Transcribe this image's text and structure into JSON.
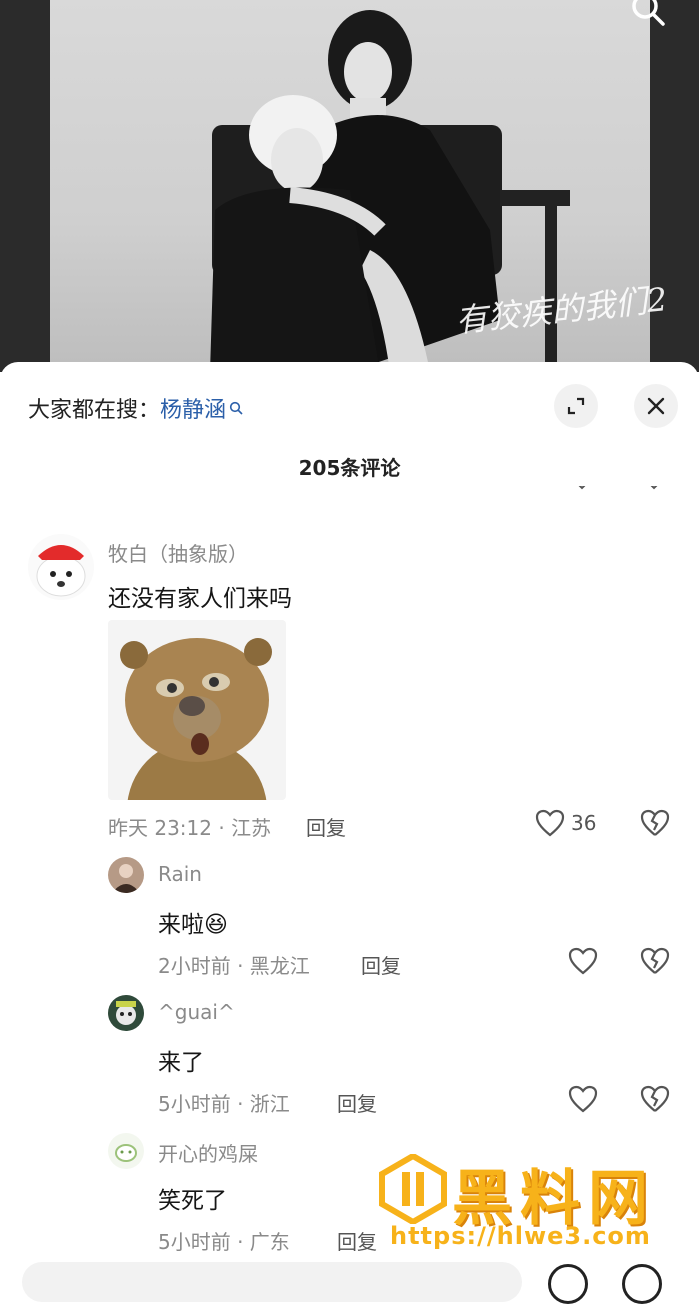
{
  "header": {
    "hot_search_prefix": "大家都在搜：",
    "hot_search_keyword": "杨静涵",
    "comment_count": "205条评论"
  },
  "photo": {
    "signature": "有狡疾的我们2"
  },
  "comments": [
    {
      "name": "牧白（抽象版）",
      "text": "还没有家人们来吗",
      "meta": "昨天 23:12 · 江苏",
      "reply": "回复",
      "likes": "36"
    },
    {
      "name": "Rain",
      "text": "来啦😆",
      "meta": "2小时前 · 黑龙江",
      "reply": "回复"
    },
    {
      "name": "^guai^",
      "text": "来了",
      "meta": "5小时前 · 浙江",
      "reply": "回复"
    },
    {
      "name": "开心的鸡屎",
      "text": "笑死了",
      "meta": "5小时前 · 广东",
      "reply": "回复"
    }
  ],
  "watermark": {
    "title": "黑料网",
    "url": "https://hlwe3.com"
  },
  "colors": {
    "keyword": "#2b5fa9",
    "watermark": "#f7b21a"
  }
}
